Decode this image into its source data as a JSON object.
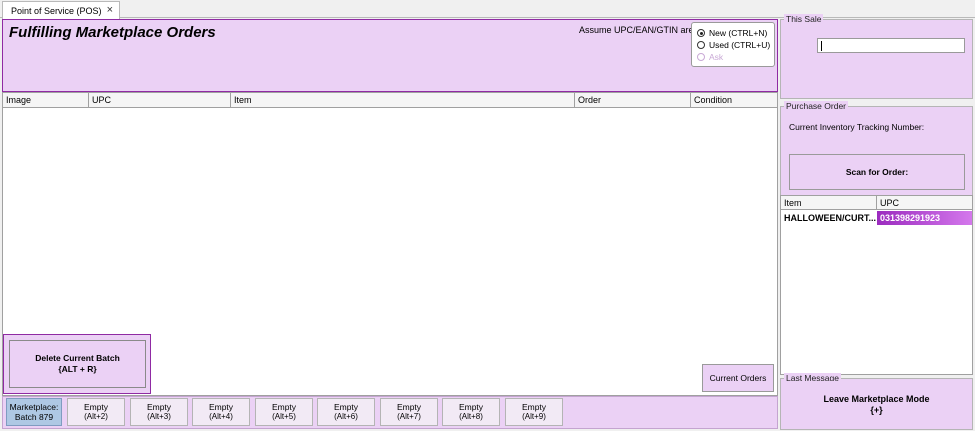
{
  "tab": {
    "label": "Point of Service (POS)",
    "close": "×"
  },
  "header": {
    "title": "Fulfilling Marketplace Orders",
    "assume_label": "Assume UPC/EAN/GTIN are:",
    "options": [
      {
        "label": "New (CTRL+N)",
        "checked": true
      },
      {
        "label": "Used (CTRL+U)",
        "checked": false
      },
      {
        "label": "Ask",
        "disabled": true
      }
    ]
  },
  "grid": {
    "columns": [
      "Image",
      "UPC",
      "Item",
      "Order",
      "Condition"
    ]
  },
  "delete_batch": {
    "line1": "Delete Current Batch",
    "line2": "{ALT + R}"
  },
  "current_orders": "Current Orders",
  "bottom": {
    "marketplace": {
      "line1": "Marketplace:",
      "line2": "Batch 879"
    },
    "slots": [
      {
        "label": "Empty",
        "key": "(Alt+2)"
      },
      {
        "label": "Empty",
        "key": "(Alt+3)"
      },
      {
        "label": "Empty",
        "key": "(Alt+4)"
      },
      {
        "label": "Empty",
        "key": "(Alt+5)"
      },
      {
        "label": "Empty",
        "key": "(Alt+6)"
      },
      {
        "label": "Empty",
        "key": "(Alt+7)"
      },
      {
        "label": "Empty",
        "key": "(Alt+8)"
      },
      {
        "label": "Empty",
        "key": "(Alt+9)"
      }
    ]
  },
  "right": {
    "this_sale": "This Sale",
    "purchase_order": "Purchase Order",
    "tracking_label": "Current Inventory Tracking Number:",
    "scan_button": "Scan for Order:",
    "grid_columns": [
      "Item",
      "UPC"
    ],
    "row": {
      "item": "HALLOWEEN/CURT...",
      "upc": "031398291923"
    },
    "last_message": "Last Message",
    "leave": {
      "line1": "Leave Marketplace Mode",
      "line2": "{+}"
    }
  }
}
